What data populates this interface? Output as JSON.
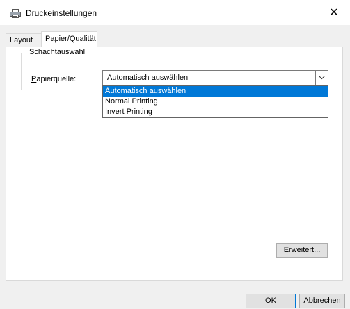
{
  "window": {
    "title": "Druckeinstellungen",
    "title_icon": "printer-icon",
    "close_icon": "close-icon",
    "close_glyph": "✕"
  },
  "tabs": [
    {
      "label": "Layout",
      "active": false
    },
    {
      "label": "Papier/Qualität",
      "active": true
    }
  ],
  "tray_group": {
    "label": "Schachtauswahl",
    "paper_source_label_first": "P",
    "paper_source_label_rest": "apierquelle:",
    "paper_source_value": "Automatisch auswählen",
    "options": [
      {
        "label": "Automatisch auswählen",
        "selected": true
      },
      {
        "label": "Normal Printing",
        "selected": false
      },
      {
        "label": "Invert Printing",
        "selected": false
      }
    ],
    "dropdown_icon": "chevron-down-icon"
  },
  "buttons": {
    "advanced_first": "E",
    "advanced_rest": "rweitert...",
    "ok": "OK",
    "cancel": "Abbrechen"
  },
  "colors": {
    "selection": "#0078d7",
    "dialog_background": "#f0f0f0"
  }
}
